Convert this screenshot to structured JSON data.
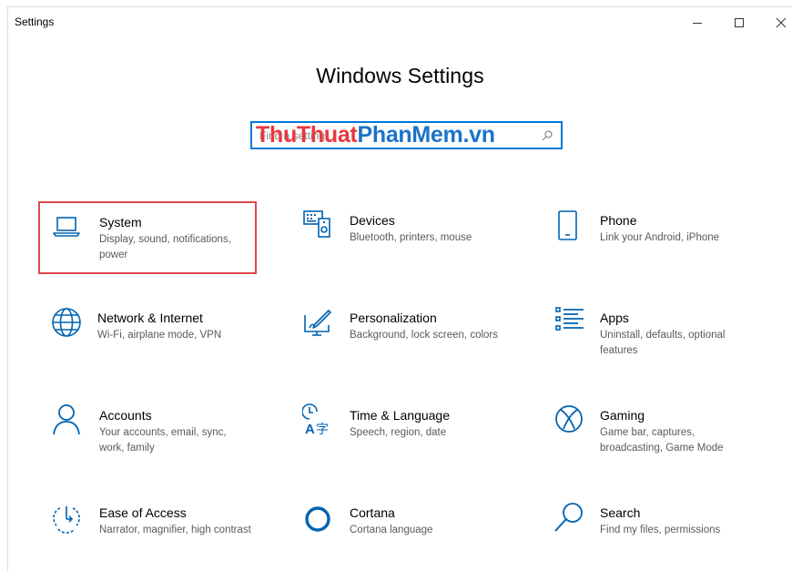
{
  "window": {
    "title": "Settings",
    "controls": [
      "minimize",
      "maximize",
      "close"
    ]
  },
  "heading": "Windows Settings",
  "search": {
    "placeholder": "Find a setting",
    "watermark_part1": "ThuThuat",
    "watermark_part2": "PhanMem.vn"
  },
  "tiles": [
    {
      "title": "System",
      "desc": "Display, sound, notifications, power",
      "icon": "laptop-icon",
      "selected": true
    },
    {
      "title": "Devices",
      "desc": "Bluetooth, printers, mouse",
      "icon": "keyboard-speaker-icon"
    },
    {
      "title": "Phone",
      "desc": "Link your Android, iPhone",
      "icon": "phone-icon"
    },
    {
      "title": "Network & Internet",
      "desc": "Wi-Fi, airplane mode, VPN",
      "icon": "globe-icon"
    },
    {
      "title": "Personalization",
      "desc": "Background, lock screen, colors",
      "icon": "paint-monitor-icon"
    },
    {
      "title": "Apps",
      "desc": "Uninstall, defaults, optional features",
      "icon": "apps-list-icon"
    },
    {
      "title": "Accounts",
      "desc": "Your accounts, email, sync, work, family",
      "icon": "person-icon"
    },
    {
      "title": "Time & Language",
      "desc": "Speech, region, date",
      "icon": "time-language-icon"
    },
    {
      "title": "Gaming",
      "desc": "Game bar, captures, broadcasting, Game Mode",
      "icon": "xbox-icon"
    },
    {
      "title": "Ease of Access",
      "desc": "Narrator, magnifier, high contrast",
      "icon": "ease-of-access-icon"
    },
    {
      "title": "Cortana",
      "desc": "Cortana language",
      "icon": "cortana-circle-icon"
    },
    {
      "title": "Search",
      "desc": "Find my files, permissions",
      "icon": "magnifier-icon"
    }
  ],
  "colors": {
    "accent": "#0078d7",
    "selection_border": "#e0474c"
  }
}
